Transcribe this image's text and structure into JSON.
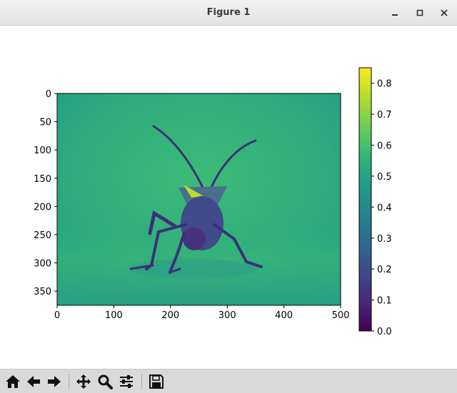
{
  "window": {
    "title": "Figure 1",
    "controls": [
      "minimize-icon",
      "maximize-icon",
      "close-icon"
    ]
  },
  "toolbar": {
    "buttons": [
      {
        "name": "home-button",
        "icon": "home-icon"
      },
      {
        "name": "back-button",
        "icon": "arrow-left-icon"
      },
      {
        "name": "forward-button",
        "icon": "arrow-right-icon"
      },
      {
        "name": "pan-button",
        "icon": "move-icon"
      },
      {
        "name": "zoom-button",
        "icon": "magnifier-icon"
      },
      {
        "name": "configure-subplots-button",
        "icon": "sliders-icon"
      },
      {
        "name": "save-button",
        "icon": "floppy-disk-icon"
      }
    ]
  },
  "chart_data": {
    "type": "heatmap",
    "image": "bug",
    "colormap": "viridis",
    "x_ticks": [
      "0",
      "100",
      "200",
      "300",
      "400",
      "500"
    ],
    "y_ticks": [
      "0",
      "50",
      "100",
      "150",
      "200",
      "250",
      "300",
      "350"
    ],
    "xlim": [
      0,
      500
    ],
    "ylim": [
      375,
      0
    ],
    "colorbar": {
      "range": [
        0.0,
        0.85
      ],
      "ticks": [
        "0.0",
        "0.1",
        "0.2",
        "0.3",
        "0.4",
        "0.5",
        "0.6",
        "0.7",
        "0.8"
      ]
    },
    "colors": {
      "viridis_stops": [
        "#440154",
        "#482878",
        "#3e4989",
        "#31688e",
        "#26828e",
        "#1f9e89",
        "#35b779",
        "#6ece58",
        "#b5de2b",
        "#fde725"
      ]
    }
  }
}
